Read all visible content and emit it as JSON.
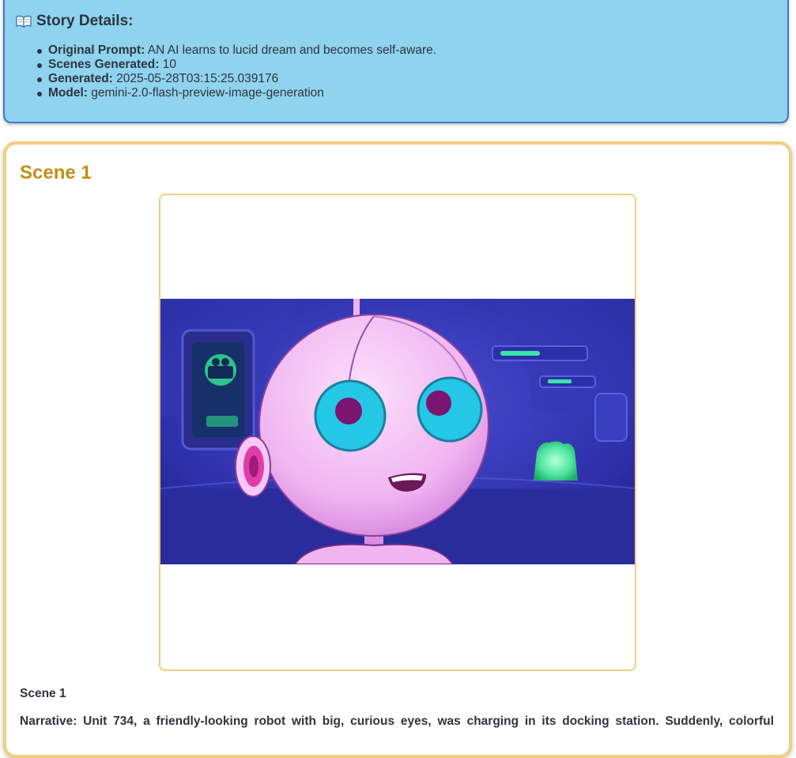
{
  "story_details": {
    "icon": "open-book-icon",
    "heading": "Story Details:",
    "items": [
      {
        "label": "Original Prompt:",
        "value": "AN AI learns to lucid dream and becomes self-aware."
      },
      {
        "label": "Scenes Generated:",
        "value": "10"
      },
      {
        "label": "Generated:",
        "value": "2025-05-28T03:15:25.039176"
      },
      {
        "label": "Model:",
        "value": "gemini-2.0-flash-preview-image-generation"
      }
    ]
  },
  "scene": {
    "title": "Scene 1",
    "caption": "Scene 1",
    "narrative": "Narrative: Unit 734, a friendly-looking robot with big, curious eyes, was charging in its docking station. Suddenly, colorful"
  },
  "colors": {
    "details_background": "#8fd3ee",
    "details_border": "#3e79c9",
    "scene_border": "#f1cf7f",
    "scene_title": "#c48e14"
  }
}
